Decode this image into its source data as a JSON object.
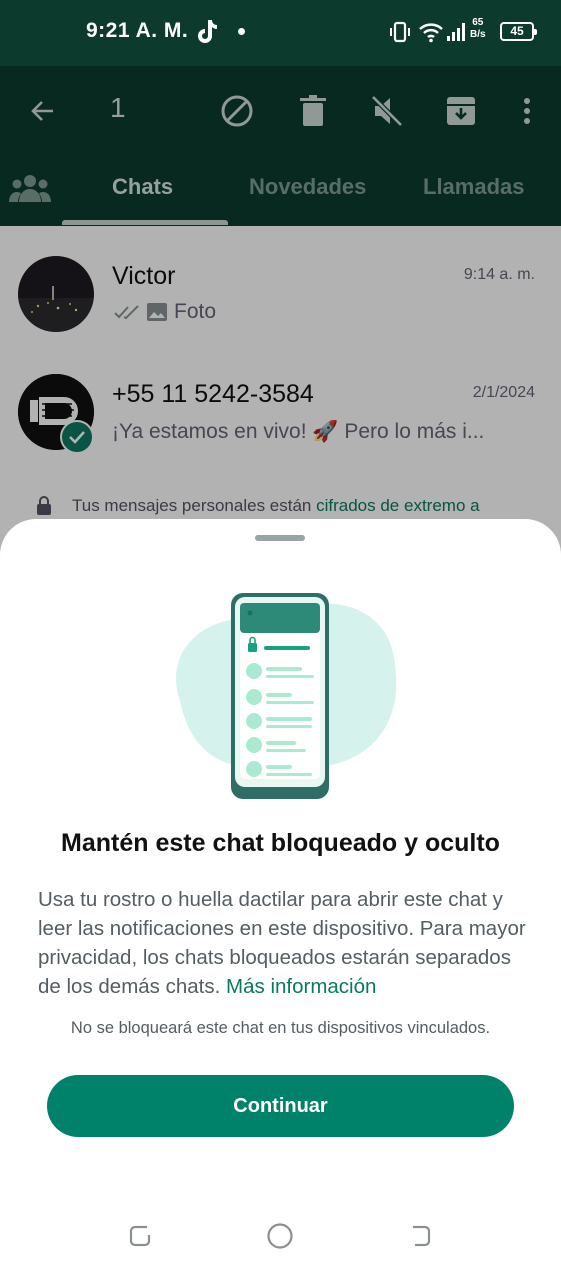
{
  "status_bar": {
    "time": "9:21 A. M.",
    "network_speed_value": "65",
    "network_speed_unit": "B/s",
    "battery_level": "45"
  },
  "action_bar": {
    "selected_count": "1",
    "icons": [
      "back-arrow-icon",
      "block-icon",
      "delete-icon",
      "mute-icon",
      "archive-icon",
      "more-vert-icon"
    ]
  },
  "tabs": [
    {
      "label": "Chats",
      "active": true
    },
    {
      "label": "Novedades",
      "active": false
    },
    {
      "label": "Llamadas",
      "active": false
    }
  ],
  "chats": [
    {
      "name": "Victor",
      "time": "9:14 a. m.",
      "preview": "Foto"
    },
    {
      "name": "+55 11 5242-3584",
      "time": "2/1/2024",
      "preview": "¡Ya estamos en vivo! 🚀  Pero lo más i..."
    }
  ],
  "encryption_note": {
    "text": "Tus mensajes personales están ",
    "link": "cifrados de extremo a"
  },
  "sheet": {
    "title": "Mantén este chat bloqueado y oculto",
    "description": "Usa tu rostro o huella dactilar para abrir este chat y leer las notificaciones en este dispositivo. Para mayor privacidad, los chats bloqueados estarán separados de los demás chats. ",
    "more_link": "Más información",
    "note": "No se bloqueará este chat en tus dispositivos vinculados.",
    "button": "Continuar"
  },
  "colors": {
    "header": "#0c3b2e",
    "accent": "#00826a",
    "link": "#0a7a5e"
  }
}
